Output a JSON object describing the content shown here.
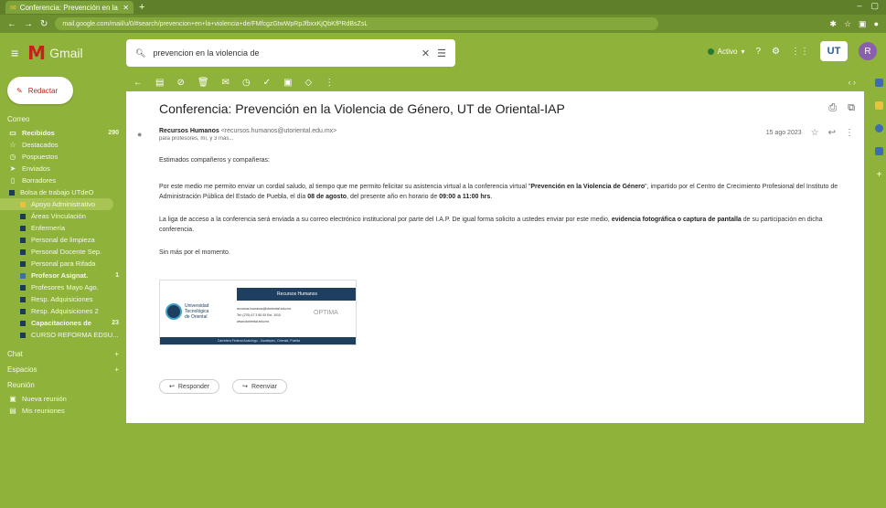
{
  "browser": {
    "tab_title": "Conferencia: Prevención en la Vi...",
    "new_tab": "+",
    "url": "mail.google.com/mail/u/0/#search/prevencion+en+la+violencia+de/FMfcgzGtwWpRpJfbxxKjQbKfPRdBsZsL"
  },
  "header": {
    "app_name": "Gmail",
    "search_value": "prevencion en la violencia de",
    "status_label": "Activo",
    "avatar_letter": "R",
    "app_logo": "UT"
  },
  "compose_label": "Redactar",
  "sidebar": {
    "section_mail": "Correo",
    "items": [
      {
        "label": "Recibidos",
        "count": "290",
        "icon": "inbox-icon",
        "glyph": "▭",
        "bold": true
      },
      {
        "label": "Destacados",
        "count": "",
        "icon": "star-icon",
        "glyph": "☆",
        "bold": false
      },
      {
        "label": "Pospuestos",
        "count": "",
        "icon": "clock-icon",
        "glyph": "◷",
        "bold": false
      },
      {
        "label": "Enviados",
        "count": "",
        "icon": "send-icon",
        "glyph": "➤",
        "bold": false
      },
      {
        "label": "Borradores",
        "count": "",
        "icon": "draft-icon",
        "glyph": "▯",
        "bold": false
      }
    ],
    "labels": [
      {
        "label": "Bolsa de trabajo UTdeO",
        "count": "",
        "color": "dark",
        "bold": false
      },
      {
        "label": "Apoyo Administrativo",
        "count": "",
        "color": "yel",
        "bold": false,
        "active": true
      },
      {
        "label": "Áreas Vinculación",
        "count": "",
        "color": "dark",
        "bold": false
      },
      {
        "label": "Enfermería",
        "count": "",
        "color": "dark",
        "bold": false
      },
      {
        "label": "Personal de limpieza",
        "count": "",
        "color": "dark",
        "bold": false
      },
      {
        "label": "Personal Docente Sep.",
        "count": "",
        "color": "dark",
        "bold": false
      },
      {
        "label": "Personal para Rifada",
        "count": "",
        "color": "dark",
        "bold": false
      },
      {
        "label": "Profesor Asignat.",
        "count": "1",
        "color": "blu",
        "bold": true
      },
      {
        "label": "Profesores Mayo Ago.",
        "count": "",
        "color": "dark",
        "bold": false
      },
      {
        "label": "Resp. Adquisiciones",
        "count": "",
        "color": "dark",
        "bold": false
      },
      {
        "label": "Resp. Adquisiciones 2",
        "count": "",
        "color": "dark",
        "bold": false
      },
      {
        "label": "Capacitaciones de",
        "count": "23",
        "color": "dark",
        "bold": true
      },
      {
        "label": "CURSO REFORMA EDSU...",
        "count": "",
        "color": "dark",
        "bold": false
      }
    ],
    "section_chat": "Chat",
    "section_spaces": "Espacios",
    "section_meet": "Reunión",
    "meet_items": [
      {
        "label": "Nueva reunión",
        "icon": "video-icon",
        "glyph": "▣"
      },
      {
        "label": "Mis reuniones",
        "icon": "calendar-icon",
        "glyph": "▤"
      }
    ]
  },
  "toolbar": {
    "pager": "‹  ›"
  },
  "message": {
    "subject": "Conferencia: Prevención en la Violencia de Género, UT de Oriental-IAP",
    "sender_name": "Recursos Humanos",
    "sender_email": "<recursos.humanos@utoriental.edu.mx>",
    "recipients": "para profesores, mí, y 3 más...",
    "date": "15 ago 2023",
    "greeting": "Estimados compañeros y compañeras:",
    "p1_a": "Por este medio me permito enviar un cordial saludo, al tiempo que me permito felicitar su asistencia virtual a la conferencia virtual \"",
    "p1_title": "Prevención en la Violencia de Género",
    "p1_b": "\", impartido por el Centro de Crecimiento Profesional del Instituto de Administración Pública del Estado de Puebla, el día ",
    "p1_date": "08 de agosto",
    "p1_c": ", del presente año en horario de ",
    "p1_time": "09:00 a 11:00 hrs",
    "p1_d": ".",
    "p2_a": "La liga de acceso a la conferencia será enviada a su correo electrónico institucional por parte del I.A.P. De igual forma solicito a ustedes enviar por este medio, ",
    "p2_bold": "evidencia fotográfica o captura de pantalla",
    "p2_b": " de su participación en dicha conferencia.",
    "closing": "Sin más por el momento.",
    "reply_label": "Responder",
    "forward_label": "Reenviar"
  },
  "signature": {
    "header": "Recursos Humanos",
    "org_line1": "Universidad",
    "org_line2": "Tecnológica",
    "org_line3": "de Oriental",
    "contacts": [
      "recursos.humanos@utoriental.edu.mx",
      "Tel: (276) 47 3 80 00 Ext. 1010",
      "www.utoriental.edu.mx"
    ],
    "brand": "OPTIMA",
    "footer": "Carretera Federal Acatzingo - Zacatepec, Oriental, Puebla"
  },
  "colors": {
    "wallpaper": "#8fb33a",
    "gmail_red": "#c5221f",
    "label_dark": "#1c3a5c"
  }
}
